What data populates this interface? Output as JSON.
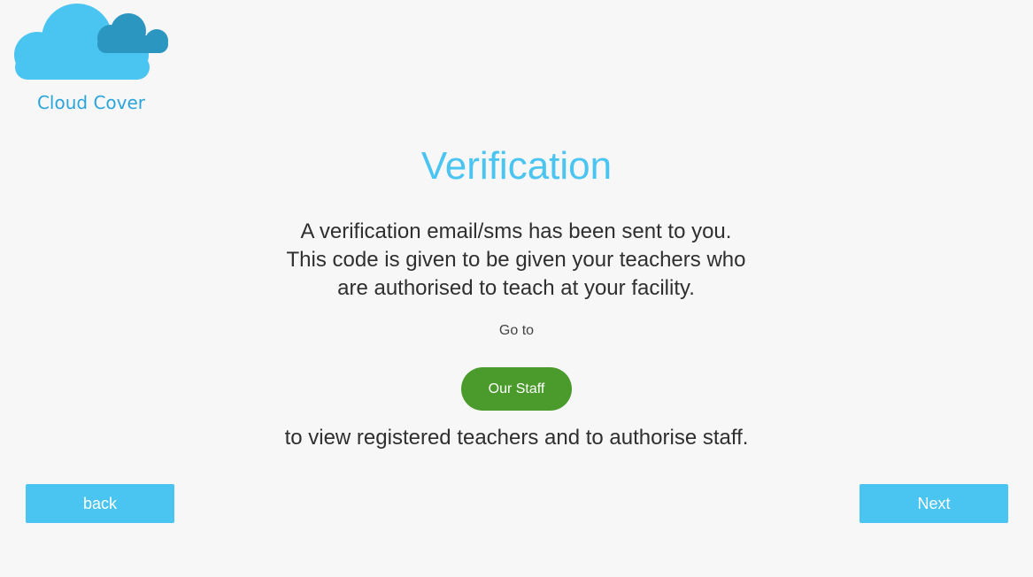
{
  "logo": {
    "name": "Cloud Cover",
    "icon": "cloud-logo-icon"
  },
  "page": {
    "title": "Verification",
    "message_lines": [
      "A verification email/sms has been sent to you.",
      "This code is given to be given your teachers who",
      "are authorised to teach at your facility."
    ],
    "goto_label": "Go to",
    "our_staff_button": "Our Staff",
    "footer_text": "to view registered teachers and to authorise staff."
  },
  "navigation": {
    "back_label": "back",
    "next_label": "Next"
  },
  "colors": {
    "accent": "#4ac4f0",
    "logo_text": "#2aa5dc",
    "button_green": "#4a9a2c",
    "cloud_light": "#4ac4f0",
    "cloud_dark": "#2b96c0",
    "background": "#f7f7f7"
  }
}
